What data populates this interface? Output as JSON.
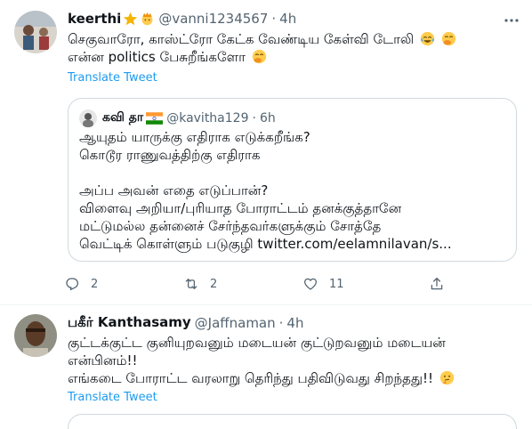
{
  "tweet1": {
    "name": "keerthi",
    "handle": "@vanni1234567",
    "separator": "·",
    "time": "4h",
    "lines": [
      "செகுவாரோ, காஸ்ட்ரோ கேட்க வேண்டிய கேள்வி டோலி",
      "என்ன politics பேசுறீங்களோ"
    ],
    "translate": "Translate Tweet",
    "quote": {
      "name": "கவி தா",
      "handle": "@kavitha129",
      "separator": "·",
      "time": "6h",
      "lines": [
        "ஆயுதம் யாருக்கு எதிராக எடுக்கறீங்க?",
        "கொடூர ராணுவத்திற்கு எதிராக",
        "அப்ப அவன் எதை எடுப்பான்?",
        "விளைவு அறியா/புரியாத போராட்டம் தனக்குத்தானே",
        "மட்டுமல்ல தன்னைச் சேர்ந்தவர்களுக்கும் சோத்தே",
        "வெட்டிக் கொள்ளும் படுகுழி twitter.com/eelamnilavan/s..."
      ]
    },
    "actions": {
      "reply_count": "2",
      "retweet_count": "2",
      "like_count": "11"
    }
  },
  "tweet2": {
    "name": "பகீர் Kanthasamy",
    "handle": "@Jaffnaman",
    "separator": "·",
    "time": "4h",
    "lines": [
      "குட்டக்குட்ட குனியுறவனும் மடையன் குட்டுறவனும் மடையன்",
      "என்பினம்!!",
      "எங்கடை போராட்ட வரலாறு தெரிந்து பதிவிடுவது சிறந்தது!!"
    ],
    "translate": "Translate Tweet"
  },
  "colors": {
    "text": "#0f1419",
    "secondary": "#536471",
    "link": "#1d9bf0",
    "border": "#cfd9de"
  }
}
